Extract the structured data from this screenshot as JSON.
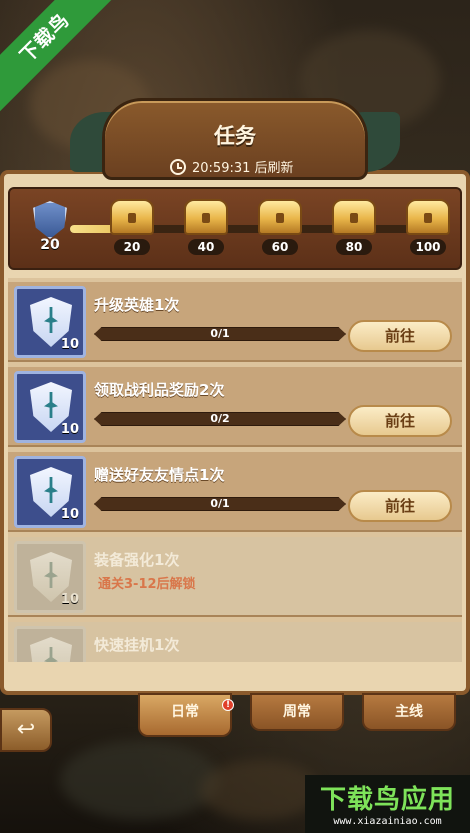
{
  "header": {
    "title": "任务",
    "timer_text": "20:59:31 后刷新"
  },
  "chest_bar": {
    "current_points": "20",
    "milestones": [
      "20",
      "40",
      "60",
      "80",
      "100"
    ],
    "progress": 0.2
  },
  "tasks": [
    {
      "title": "升级英雄1次",
      "reward": "10",
      "progress": "0/1",
      "button": "前往",
      "locked": false
    },
    {
      "title": "领取战利品奖励2次",
      "reward": "10",
      "progress": "0/2",
      "button": "前往",
      "locked": false
    },
    {
      "title": "赠送好友友情点1次",
      "reward": "10",
      "progress": "0/1",
      "button": "前往",
      "locked": false
    },
    {
      "title": "装备强化1次",
      "reward": "10",
      "lock_text": "通关3-12后解锁",
      "locked": true
    },
    {
      "title": "快速挂机1次",
      "locked": true
    }
  ],
  "tabs": [
    {
      "label": "日常",
      "active": true,
      "badge": "!"
    },
    {
      "label": "周常",
      "active": false
    },
    {
      "label": "主线",
      "active": false
    }
  ],
  "watermark": {
    "corner": "下载鸟",
    "brand": "下载鸟应用",
    "url": "www.xiazainiao.com"
  },
  "colors": {
    "panel": "#e9d5b0",
    "wood": "#8a5a2c",
    "accent_button": "#f4dca8"
  }
}
